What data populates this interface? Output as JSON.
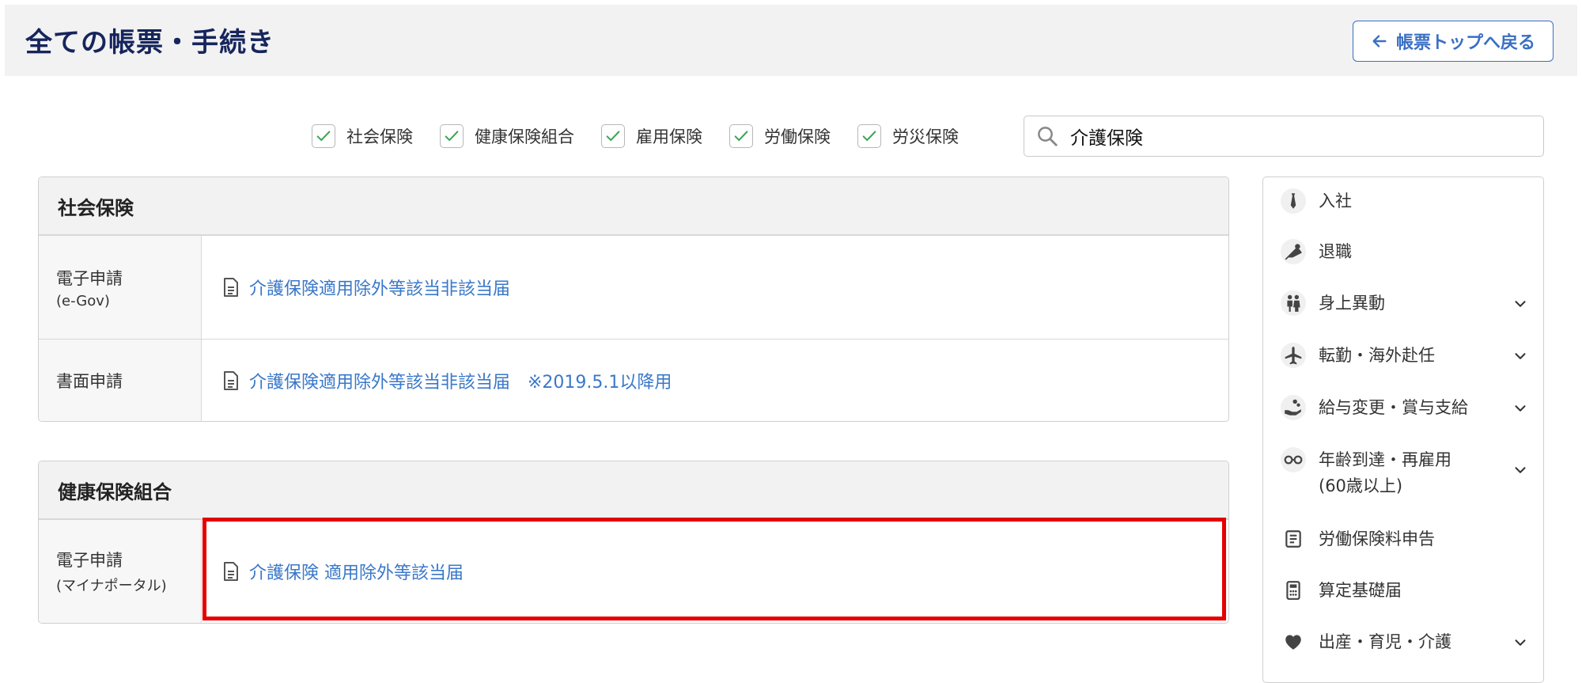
{
  "header": {
    "title": "全ての帳票・手続き",
    "back_label": "帳票トップへ戻る"
  },
  "filters": [
    {
      "label": "社会保険",
      "checked": true
    },
    {
      "label": "健康保険組合",
      "checked": true
    },
    {
      "label": "雇用保険",
      "checked": true
    },
    {
      "label": "労働保険",
      "checked": true
    },
    {
      "label": "労災保険",
      "checked": true
    }
  ],
  "search": {
    "value": "介護保険"
  },
  "sections": [
    {
      "title": "社会保険",
      "rows": [
        {
          "label": "電子申請",
          "sublabel": "(e-Gov)",
          "link": "介護保険適用除外等該当非該当届"
        },
        {
          "label": "書面申請",
          "sublabel": "",
          "link": "介護保険適用除外等該当非該当届　※2019.5.1以降用"
        }
      ]
    },
    {
      "title": "健康保険組合",
      "rows": [
        {
          "label": "電子申請",
          "sublabel": "(マイナポータル)",
          "link": "介護保険 適用除外等該当届"
        }
      ]
    }
  ],
  "sidebar": {
    "items": [
      {
        "label": "入社",
        "icon": "tie-icon",
        "expandable": false
      },
      {
        "label": "退職",
        "icon": "bouquet-icon",
        "expandable": false
      },
      {
        "label": "身上異動",
        "icon": "couple-icon",
        "expandable": true
      },
      {
        "label": "転勤・海外赴任",
        "icon": "airplane-icon",
        "expandable": true
      },
      {
        "label": "給与変更・賞与支給",
        "icon": "money-hand-icon",
        "expandable": true
      },
      {
        "label": "年齢到達・再雇用\n(60歳以上)",
        "icon": "glasses-icon",
        "expandable": true
      },
      {
        "label": "労働保険料申告",
        "icon": "document-lines-icon",
        "expandable": false
      },
      {
        "label": "算定基礎届",
        "icon": "calculator-icon",
        "expandable": false
      },
      {
        "label": "出産・育児・介護",
        "icon": "heart-icon",
        "expandable": true
      }
    ]
  },
  "colors": {
    "title": "#16255c",
    "link": "#3a78c9",
    "accent": "#3a6fc4",
    "check": "#3aa655",
    "highlight": "#e60000"
  }
}
